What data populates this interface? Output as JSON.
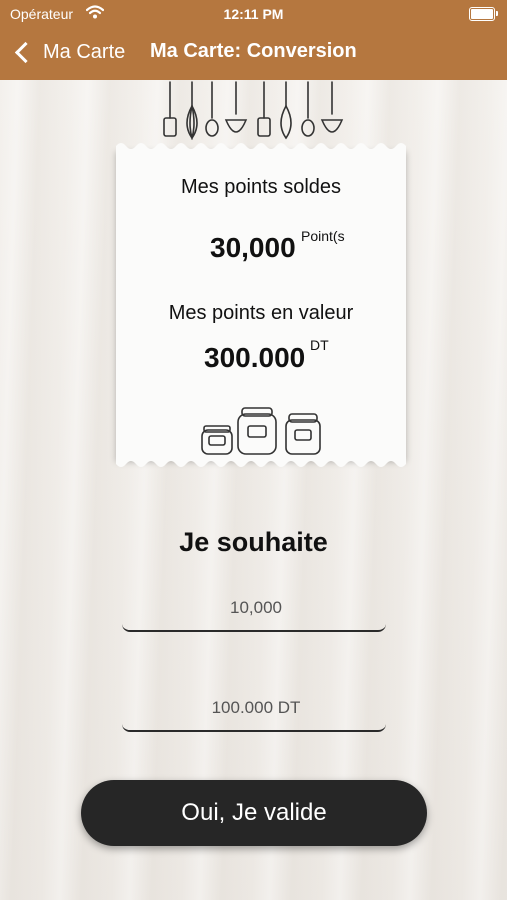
{
  "status_bar": {
    "carrier": "Opérateur",
    "time": "12:11 PM",
    "icons": [
      "wifi-icon",
      "battery-icon"
    ]
  },
  "nav": {
    "back_label": "Ma Carte",
    "title": "Ma Carte: Conversion",
    "bar_color": "#b5773f"
  },
  "card": {
    "balance_label": "Mes points soldes",
    "balance_value": "30,000",
    "balance_unit": "Point(s",
    "value_label": "Mes points en valeur",
    "value_amount": "300.000",
    "value_unit": "DT",
    "decorations": [
      "utensils-illustration",
      "jars-illustration"
    ]
  },
  "form": {
    "heading": "Je souhaite",
    "points_value": "10,000",
    "amount_value": "100.000 DT",
    "submit_label": "Oui, Je valide",
    "button_color": "#262626"
  }
}
